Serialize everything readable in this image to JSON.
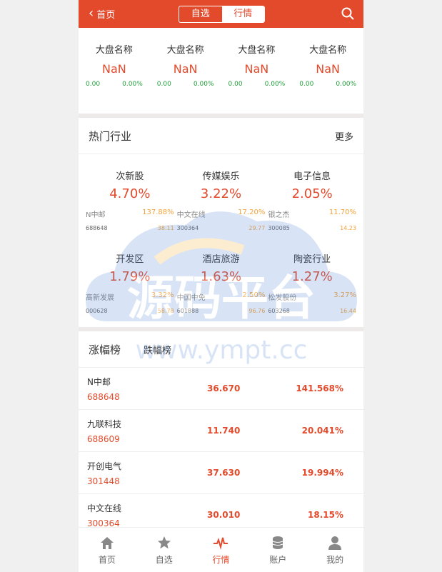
{
  "header": {
    "back_label": "首页",
    "tabs": [
      "自选",
      "行情"
    ]
  },
  "indices": [
    {
      "name": "大盘名称",
      "value": "NaN",
      "change": "0.00",
      "percent": "0.00%"
    },
    {
      "name": "大盘名称",
      "value": "NaN",
      "change": "0.00",
      "percent": "0.00%"
    },
    {
      "name": "大盘名称",
      "value": "NaN",
      "change": "0.00",
      "percent": "0.00%"
    },
    {
      "name": "大盘名称",
      "value": "NaN",
      "change": "0.00",
      "percent": "0.00%"
    }
  ],
  "hot": {
    "title": "热门行业",
    "more": "更多",
    "items": [
      {
        "name": "次新股",
        "pct": "4.70%",
        "stock": "N中邮",
        "stock_pct": "137.88%",
        "code": "688648",
        "price": "38.11"
      },
      {
        "name": "传媒娱乐",
        "pct": "3.22%",
        "stock": "中文在线",
        "stock_pct": "17.20%",
        "code": "300364",
        "price": "29.77"
      },
      {
        "name": "电子信息",
        "pct": "2.05%",
        "stock": "银之杰",
        "stock_pct": "11.70%",
        "code": "300085",
        "price": "14.23"
      },
      {
        "name": "开发区",
        "pct": "1.79%",
        "stock": "高新发展",
        "stock_pct": "3.32%",
        "code": "000628",
        "price": "58.78"
      },
      {
        "name": "酒店旅游",
        "pct": "1.63%",
        "stock": "中国中免",
        "stock_pct": "2.50%",
        "code": "601888",
        "price": "96.76"
      },
      {
        "name": "陶瓷行业",
        "pct": "1.27%",
        "stock": "松发股份",
        "stock_pct": "3.27%",
        "code": "603268",
        "price": "16.44"
      }
    ]
  },
  "ranking": {
    "tab_up": "涨幅榜",
    "tab_down": "跌幅榜",
    "rows": [
      {
        "name": "N中邮",
        "code": "688648",
        "price": "36.670",
        "pct": "141.568%"
      },
      {
        "name": "九联科技",
        "code": "688609",
        "price": "11.740",
        "pct": "20.041%"
      },
      {
        "name": "开创电气",
        "code": "301448",
        "price": "37.630",
        "pct": "19.994%"
      },
      {
        "name": "中文在线",
        "code": "300364",
        "price": "30.010",
        "pct": "18.15%"
      }
    ]
  },
  "watermark": {
    "text": "源码平台",
    "url": "www.ympt.cc"
  },
  "tabbar": [
    {
      "label": "首页",
      "icon": "home-icon"
    },
    {
      "label": "自选",
      "icon": "star-icon"
    },
    {
      "label": "行情",
      "icon": "pulse-icon"
    },
    {
      "label": "账户",
      "icon": "coins-icon"
    },
    {
      "label": "我的",
      "icon": "user-icon"
    }
  ],
  "colors": {
    "brand": "#e24a2b",
    "up": "#e24a2b",
    "down": "#1f9e3a",
    "secondary": "#f4a23a"
  }
}
